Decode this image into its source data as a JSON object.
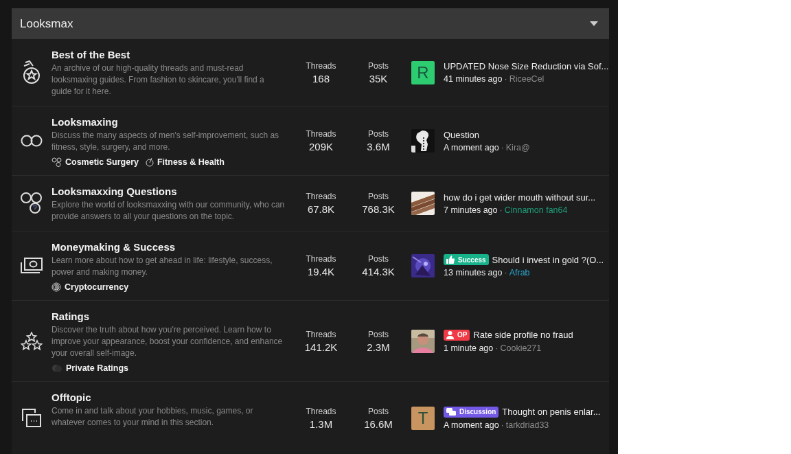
{
  "category": {
    "title": "Looksmax"
  },
  "nodes": [
    {
      "title": "Best of the Best",
      "description": "An archive of our high-quality threads and must-read looksmaxing guides. From fashion to skincare, you'll find a guide for it here.",
      "stats": [
        {
          "label": "Threads",
          "value": "168"
        },
        {
          "label": "Posts",
          "value": "35K"
        }
      ],
      "latest": {
        "avatar": {
          "kind": "letter",
          "letter": "R",
          "color": "#2ecc71"
        },
        "title": "UPDATED Nose Size Reduction via Sof...",
        "time": "41 minutes ago",
        "separator": "·",
        "user": {
          "name": "RiceeCel",
          "color": "#8c8c8c"
        }
      }
    },
    {
      "title": "Looksmaxing",
      "description": "Discuss the many aspects of men's self-improvement, such as fitness, style, surgery, and more.",
      "subforums": [
        {
          "label": "Cosmetic Surgery"
        },
        {
          "label": "Fitness & Health"
        }
      ],
      "stats": [
        {
          "label": "Threads",
          "value": "209K"
        },
        {
          "label": "Posts",
          "value": "3.6M"
        }
      ],
      "latest": {
        "title": "Question",
        "time": "A moment ago",
        "separator": "·",
        "user": {
          "name": "Kira@",
          "color": "#8c8c8c"
        }
      }
    },
    {
      "title": "Looksmaxxing Questions",
      "description": "Explore the world of looksmaxxing with our community, who can provide answers to all your questions on the topic.",
      "stats": [
        {
          "label": "Threads",
          "value": "67.8K"
        },
        {
          "label": "Posts",
          "value": "768.3K"
        }
      ],
      "latest": {
        "title": "how do i get wider mouth without sur...",
        "time": "7 minutes ago",
        "separator": "·",
        "user": {
          "name": "Cinnamon fan64",
          "color": "#1e9c78"
        }
      }
    },
    {
      "title": "Moneymaking & Success",
      "description": "Learn more about how to get ahead in life: lifestyle, success, power and making money.",
      "subforums": [
        {
          "label": "Cryptocurrency"
        }
      ],
      "stats": [
        {
          "label": "Threads",
          "value": "19.4K"
        },
        {
          "label": "Posts",
          "value": "414.3K"
        }
      ],
      "latest": {
        "prefix": {
          "kind": "success",
          "text": "Success",
          "color": "#17b28a"
        },
        "title": "Should i invest in gold ?(O...",
        "time": "13 minutes ago",
        "separator": "·",
        "user": {
          "name": "Afrab",
          "color": "#2aa7cf"
        }
      }
    },
    {
      "title": "Ratings",
      "description": "Discover the truth about how you're perceived. Learn how to improve your appearance, boost your confidence, and enhance your overall self-image.",
      "subforums": [
        {
          "label": "Private Ratings"
        }
      ],
      "stats": [
        {
          "label": "Threads",
          "value": "141.2K"
        },
        {
          "label": "Posts",
          "value": "2.3M"
        }
      ],
      "latest": {
        "prefix": {
          "kind": "op",
          "text": "OP",
          "color": "#f03a45"
        },
        "title": "Rate side profile no fraud",
        "time": "1 minute ago",
        "separator": "·",
        "user": {
          "name": "Cookie271",
          "color": "#8c8c8c"
        }
      }
    },
    {
      "title": "Offtopic",
      "description": "Come in and talk about your hobbies, music, games, or whatever comes to your mind in this section.",
      "stats": [
        {
          "label": "Threads",
          "value": "1.3M"
        },
        {
          "label": "Posts",
          "value": "16.6M"
        }
      ],
      "latest": {
        "avatar": {
          "kind": "letter",
          "letter": "T",
          "color": "#c8945f"
        },
        "prefix": {
          "kind": "discussion",
          "text": "Discussion",
          "color": "#7359e6"
        },
        "title": "Thought on penis enlar...",
        "time": "A moment ago",
        "separator": "·",
        "user": {
          "name": "tarkdriad33",
          "color": "#8c8c8c"
        }
      }
    }
  ]
}
